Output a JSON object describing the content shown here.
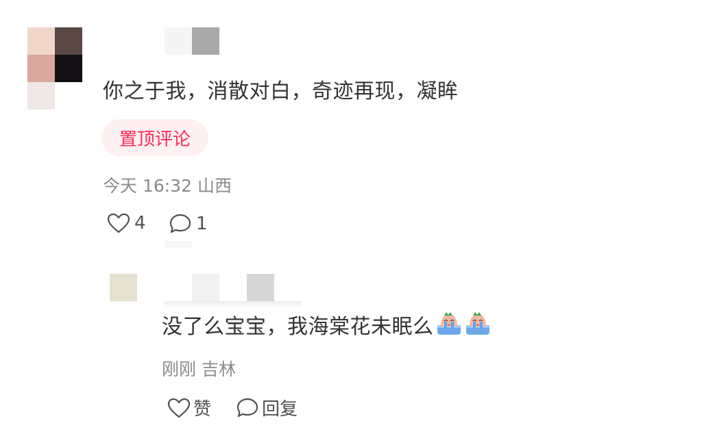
{
  "comment": {
    "text": "你之于我，消散对白，奇迹再现，凝眸",
    "pin_tag": "置顶评论",
    "time": "今天 16:32",
    "location": "山西",
    "likes": "4",
    "replies": "1",
    "colors": {
      "pin_text": "#fe2c55",
      "pin_bg": "#fff0f2"
    }
  },
  "reply": {
    "text": "没了么宝宝，我海棠花未眠么",
    "emoji": [
      "crying-face-emoji",
      "crying-face-emoji"
    ],
    "time": "刚刚",
    "location": "吉林",
    "like_label": "赞",
    "reply_label": "回复"
  },
  "icons": {
    "like": "heart-outline-icon",
    "comment": "speech-bubble-icon"
  }
}
